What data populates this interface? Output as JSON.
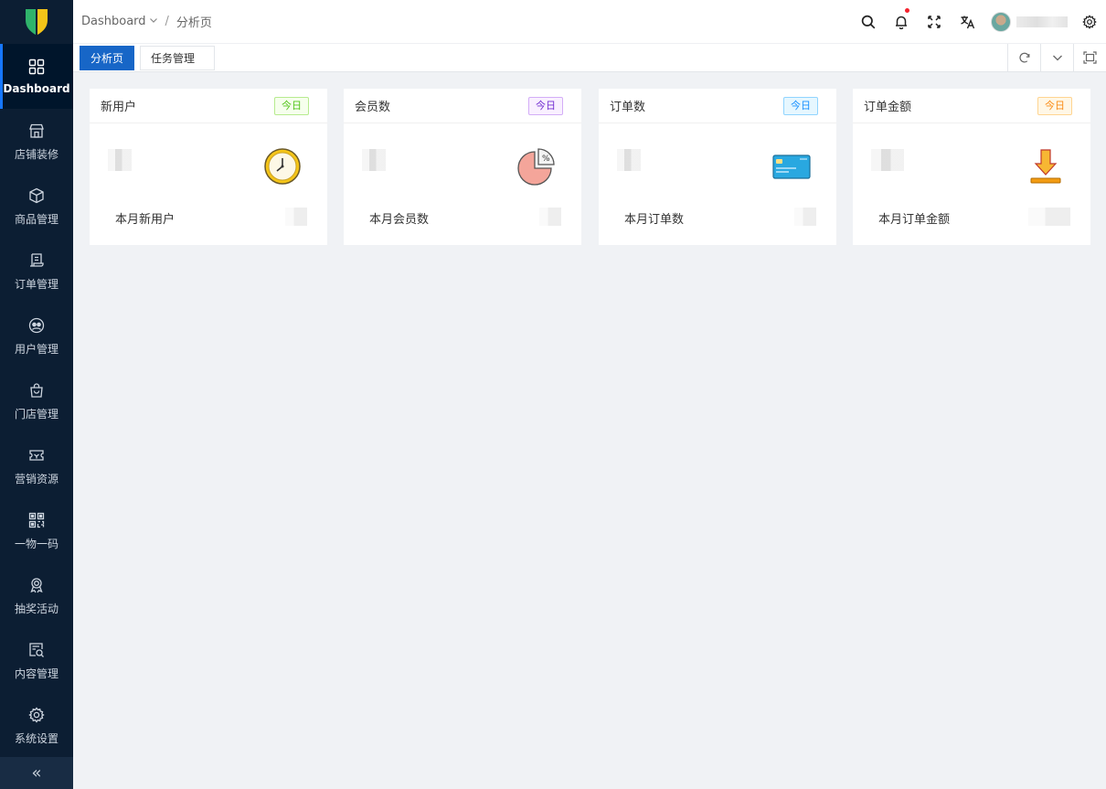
{
  "breadcrumb": {
    "root": "Dashboard",
    "separator": "/",
    "current": "分析页"
  },
  "header": {
    "icons": [
      "search-icon",
      "bell-icon",
      "fullscreen-icon",
      "translate-icon",
      "settings-icon"
    ]
  },
  "sidebar": {
    "items": [
      {
        "label": "Dashboard",
        "icon": "grid-icon",
        "active": true
      },
      {
        "label": "店铺装修",
        "icon": "shop-icon"
      },
      {
        "label": "商品管理",
        "icon": "cube-icon"
      },
      {
        "label": "订单管理",
        "icon": "receipt-icon"
      },
      {
        "label": "用户管理",
        "icon": "users-icon"
      },
      {
        "label": "门店管理",
        "icon": "bag-icon"
      },
      {
        "label": "营销资源",
        "icon": "ticket-icon"
      },
      {
        "label": "一物一码",
        "icon": "qrcode-icon"
      },
      {
        "label": "抽奖活动",
        "icon": "award-icon"
      },
      {
        "label": "内容管理",
        "icon": "content-search-icon"
      },
      {
        "label": "系统设置",
        "icon": "gear-icon"
      }
    ],
    "collapse_label": "«"
  },
  "tabs": [
    {
      "label": "分析页",
      "active": true
    },
    {
      "label": "任务管理",
      "active": false
    }
  ],
  "cards": [
    {
      "title": "新用户",
      "badge": "今日",
      "badge_color": "#52c41a",
      "footer_label": "本月新用户",
      "icon": "clock-icon"
    },
    {
      "title": "会员数",
      "badge": "今日",
      "badge_color": "#722ed1",
      "footer_label": "本月会员数",
      "icon": "pie-chart-icon"
    },
    {
      "title": "订单数",
      "badge": "今日",
      "badge_color": "#1890ff",
      "footer_label": "本月订单数",
      "icon": "credit-card-icon"
    },
    {
      "title": "订单金额",
      "badge": "今日",
      "badge_color": "#fa8c16",
      "footer_label": "本月订单金额",
      "icon": "download-icon"
    }
  ],
  "colors": {
    "sidebar_bg": "#0c1e33",
    "accent": "#1766c7",
    "notify_dot": "#f5222d"
  }
}
